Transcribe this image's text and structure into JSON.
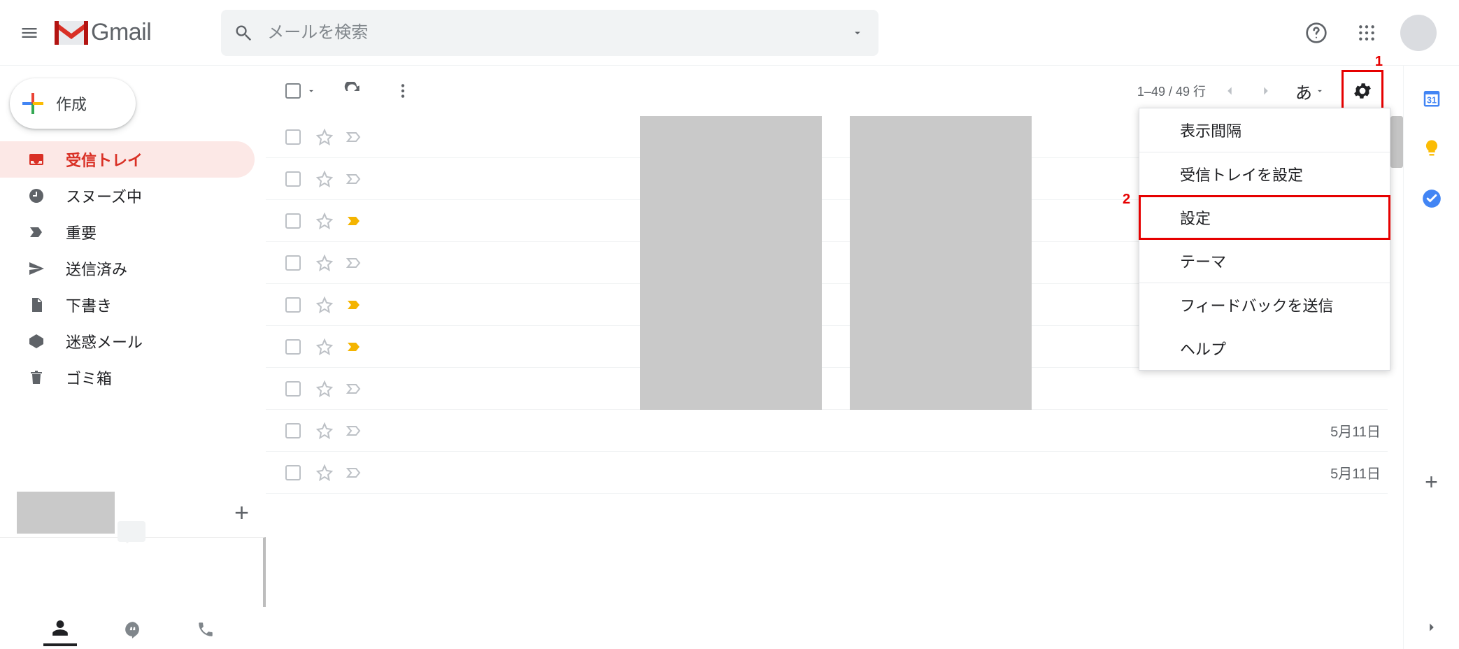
{
  "header": {
    "product_name": "Gmail",
    "search_placeholder": "メールを検索"
  },
  "compose_label": "作成",
  "sidebar": {
    "items": [
      {
        "label": "受信トレイ",
        "icon": "inbox",
        "active": true
      },
      {
        "label": "スヌーズ中",
        "icon": "clock",
        "active": false
      },
      {
        "label": "重要",
        "icon": "important",
        "active": false
      },
      {
        "label": "送信済み",
        "icon": "send",
        "active": false
      },
      {
        "label": "下書き",
        "icon": "draft",
        "active": false
      },
      {
        "label": "迷惑メール",
        "icon": "spam",
        "active": false
      },
      {
        "label": "ゴミ箱",
        "icon": "trash",
        "active": false
      }
    ]
  },
  "toolbar": {
    "pagination": "1–49 / 49 行",
    "input_mode": "あ"
  },
  "settings_menu": {
    "items": [
      "表示間隔",
      "受信トレイを設定",
      "設定",
      "テーマ",
      "フィードバックを送信",
      "ヘルプ"
    ],
    "highlight_index": 2
  },
  "annotations": {
    "marker_1": "1",
    "marker_2": "2"
  },
  "threads": [
    {
      "important": false,
      "date": ""
    },
    {
      "important": false,
      "date": ""
    },
    {
      "important": true,
      "date": ""
    },
    {
      "important": false,
      "date": ""
    },
    {
      "important": true,
      "date": ""
    },
    {
      "important": true,
      "date": ""
    },
    {
      "important": false,
      "date": ""
    },
    {
      "important": false,
      "date": "5月11日"
    },
    {
      "important": false,
      "date": "5月11日"
    }
  ],
  "icons": {
    "menu": "menu-icon",
    "search": "search-icon",
    "dropdown": "dropdown-icon",
    "help": "help-icon",
    "apps": "apps-icon",
    "refresh": "refresh-icon",
    "more": "more-icon",
    "prev": "chevron-left-icon",
    "next": "chevron-right-icon",
    "gear": "gear-icon",
    "star_empty": "star-outline-icon",
    "label_important_off": "label-important-outline-icon",
    "label_important_on": "label-important-filled-icon",
    "calendar": "calendar-icon",
    "keep": "keep-icon",
    "tasks": "tasks-icon",
    "plus": "plus-icon",
    "chevron_right": "chevron-right-icon",
    "person": "person-icon",
    "hangouts": "hangouts-icon",
    "phone": "phone-icon"
  }
}
